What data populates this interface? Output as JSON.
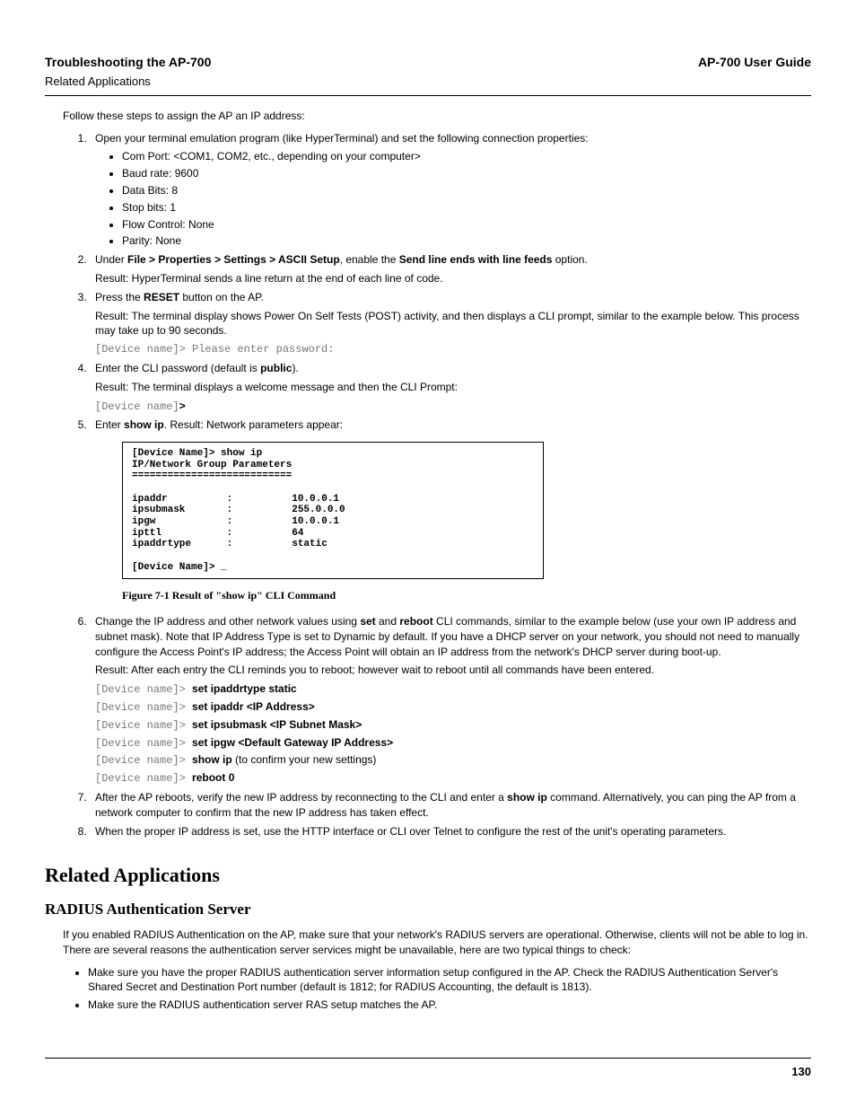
{
  "header": {
    "left_title": "Troubleshooting the AP-700",
    "left_sub": "Related Applications",
    "right": "AP-700 User Guide"
  },
  "intro": "Follow these steps to assign the AP an IP address:",
  "steps": {
    "s1": {
      "text": "Open your terminal emulation program (like HyperTerminal) and set the following connection properties:",
      "b1": "Com Port: <COM1, COM2, etc., depending on your computer>",
      "b2": "Baud rate: 9600",
      "b3": "Data Bits: 8",
      "b4": "Stop bits: 1",
      "b5": "Flow Control: None",
      "b6": "Parity: None"
    },
    "s2": {
      "pre": "Under ",
      "bold1": "File > Properties > Settings > ASCII Setup",
      "mid": ", enable the ",
      "bold2": "Send line ends with line feeds",
      "post": " option.",
      "result": "Result: HyperTerminal sends a line return at the end of each line of code."
    },
    "s3": {
      "pre": "Press the ",
      "bold": "RESET",
      "post": " button on the AP.",
      "result": "Result: The terminal display shows Power On Self Tests (POST) activity, and then displays a CLI prompt, similar to the example below. This process may take up to 90 seconds.",
      "cli": "[Device name]> Please enter password:"
    },
    "s4": {
      "pre": "Enter the CLI password (default is ",
      "bold": "public",
      "post": ").",
      "result": "Result: The terminal displays a welcome message and then the CLI Prompt:",
      "cli_prefix": "[Device name]",
      "cli_suffix": ">"
    },
    "s5": {
      "pre": "Enter ",
      "bold": "show ip",
      "post": ". Result: Network parameters appear:"
    },
    "s6": {
      "pre": "Change the IP address and other network values using ",
      "bold1": "set",
      "mid1": " and ",
      "bold2": "reboot",
      "post": " CLI commands, similar to the example below (use your own IP address and subnet mask). Note that IP Address Type is set to Dynamic by default. If you have a DHCP server on your network, you should not need to manually configure the Access Point's IP address; the Access Point will obtain an IP address from the network's DHCP server during boot-up.",
      "result": "Result: After each entry the CLI reminds you to reboot; however wait to reboot until all commands have been entered.",
      "prompt": "[Device name]> ",
      "c1": "set ipaddrtype static",
      "c2": "set ipaddr <IP Address>",
      "c3": "set ipsubmask <IP Subnet Mask>",
      "c4": "set ipgw <Default Gateway IP Address>",
      "c5": "show ip",
      "c5_note": "  (to confirm your new settings)",
      "c6": "reboot 0"
    },
    "s7": {
      "pre": "After the AP reboots, verify the new IP address by reconnecting to the CLI and enter a ",
      "bold": "show ip",
      "post": " command. Alternatively, you can ping the AP from a network computer to confirm that the new IP address has taken effect."
    },
    "s8": "When the proper IP address is set, use the HTTP interface or CLI over Telnet to configure the rest of the unit's operating parameters."
  },
  "cli_box": "[Device Name]> show ip\nIP/Network Group Parameters\n===========================\n\nipaddr          :          10.0.0.1\nipsubmask       :          255.0.0.0\nipgw            :          10.0.0.1\nipttl           :          64\nipaddrtype      :          static\n\n[Device Name]> _",
  "figure_caption": "Figure 7-1     Result of \"show ip\" CLI Command",
  "related": {
    "title": "Related Applications",
    "radius": {
      "title": "RADIUS Authentication Server",
      "intro": "If you enabled RADIUS Authentication on the AP, make sure that your network's RADIUS servers are operational. Otherwise, clients will not be able to log in. There are several reasons the authentication server services might be unavailable, here are two typical things to check:",
      "b1": "Make sure you have the proper RADIUS authentication server information setup configured in the AP. Check the RADIUS Authentication Server's Shared Secret and Destination Port number (default is 1812; for RADIUS Accounting, the default is 1813).",
      "b2": "Make sure the RADIUS authentication server RAS setup matches the AP."
    }
  },
  "page_number": "130"
}
